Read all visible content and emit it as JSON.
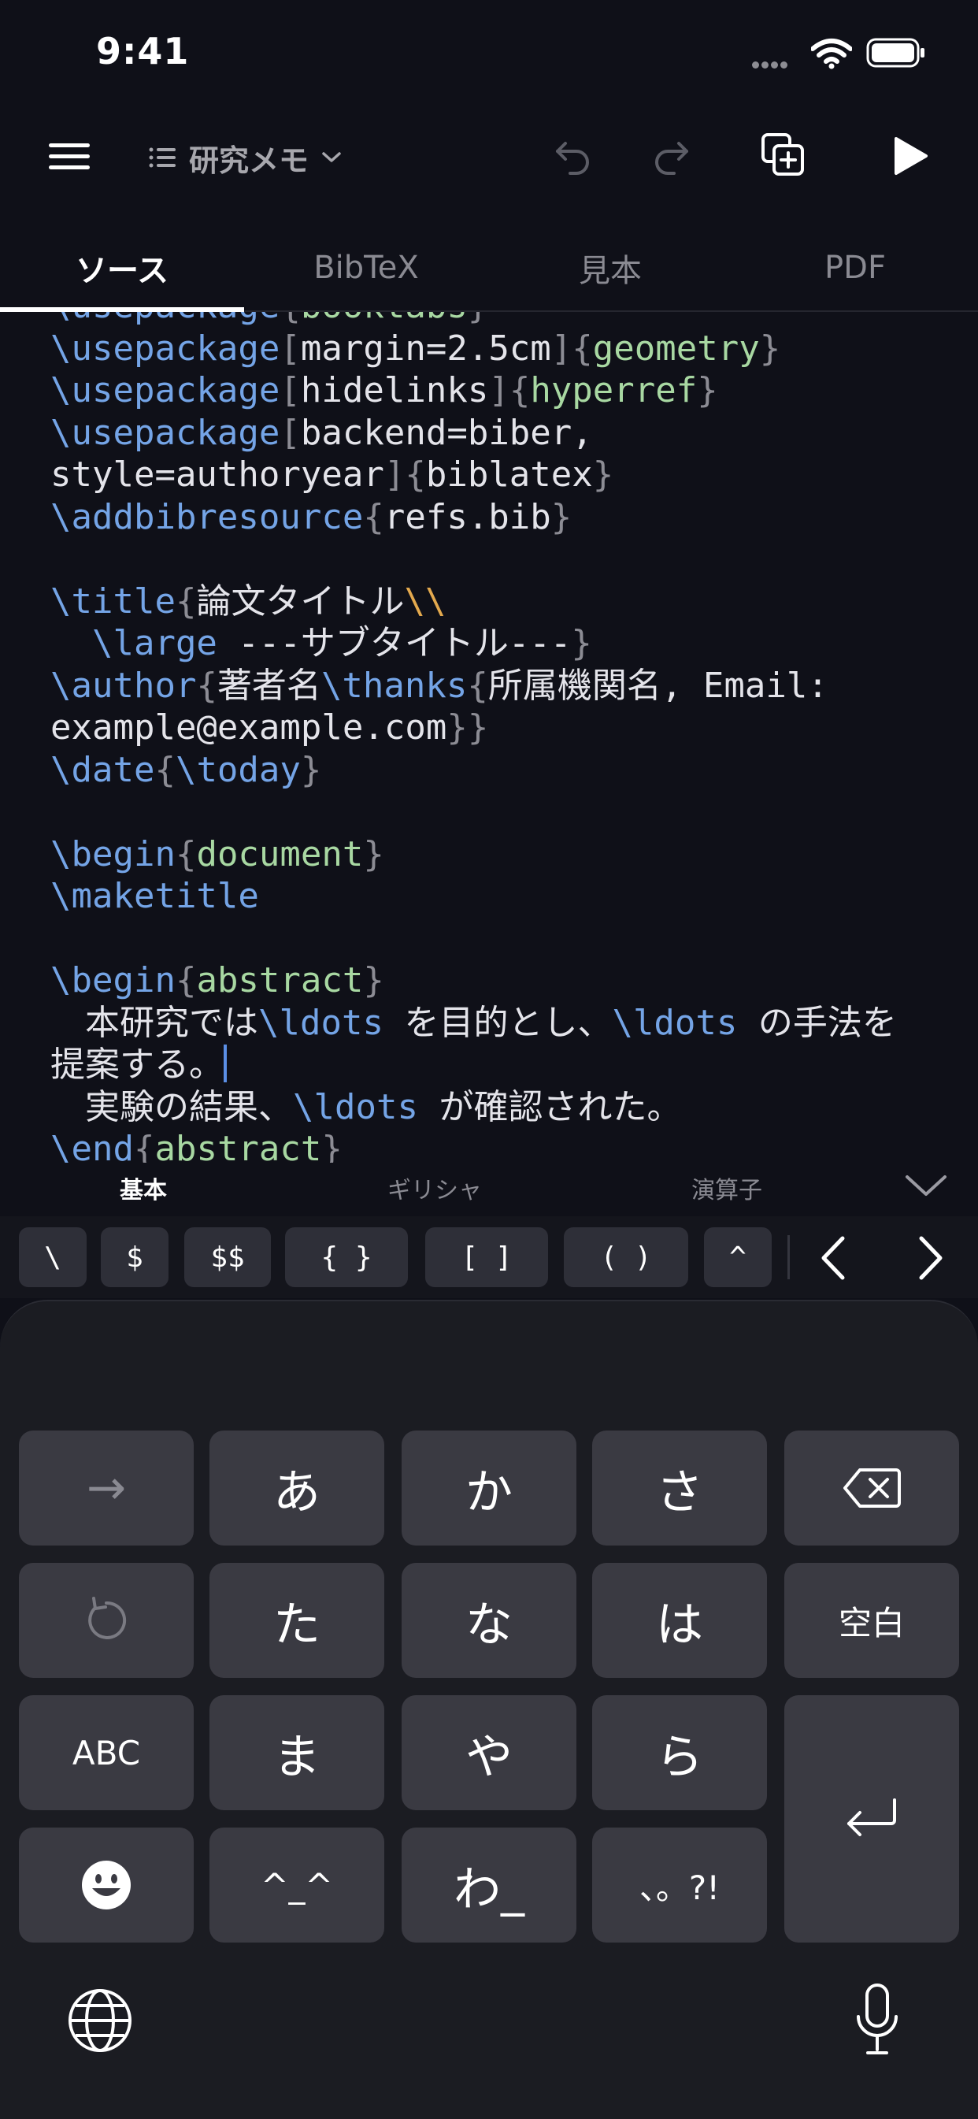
{
  "status": {
    "time": "9:41"
  },
  "toolbar": {
    "document_title": "研究メモ"
  },
  "tabs": [
    {
      "label": "ソース",
      "active": true
    },
    {
      "label": "BibTeX",
      "active": false
    },
    {
      "label": "見本",
      "active": false
    },
    {
      "label": "PDF",
      "active": false
    }
  ],
  "editor": {
    "lines": [
      "\\usepackage{booktabs}",
      "\\usepackage[margin=2.5cm]{geometry}",
      "\\usepackage[hidelinks]{hyperref}",
      "\\usepackage[backend=biber,",
      "style=authoryear]{biblatex}",
      "\\addbibresource{refs.bib}",
      "",
      "\\title{論文タイトル\\\\",
      "  \\large ---サブタイトル---}",
      "\\author{著者名\\thanks{所属機関名, Email:",
      "example@example.com}}",
      "\\date{\\today}",
      "",
      "\\begin{document}",
      "\\maketitle",
      "",
      "\\begin{abstract}",
      "　本研究では\\ldots を目的とし、\\ldots の手法を",
      "提案する。",
      "　実験の結果、\\ldots が確認された。",
      "\\end{abstract}"
    ]
  },
  "snippets": {
    "categories": [
      {
        "label": "基本",
        "active": true
      },
      {
        "label": "ギリシャ",
        "active": false
      },
      {
        "label": "演算子",
        "active": false
      }
    ],
    "keys": [
      "\\",
      "$",
      "$$",
      "{ }",
      "[ ]",
      "( )",
      "^"
    ]
  },
  "keyboard": {
    "rows": [
      [
        "→",
        "あ",
        "か",
        "さ",
        "⌫"
      ],
      [
        "↺",
        "た",
        "な",
        "は",
        "空白"
      ],
      [
        "ABC",
        "ま",
        "や",
        "ら",
        "↵"
      ],
      [
        "☻",
        "^_^",
        "わ_",
        "、。?!"
      ]
    ]
  },
  "colors": {
    "background": "#0f1018",
    "command": "#74a4e6",
    "environment": "#a8d8a2",
    "brace": "#8c8c94",
    "escaped": "#e3a94e",
    "caret": "#5b8fe6",
    "key": "#3a3a42"
  },
  "icons": [
    "wifi-icon",
    "battery-icon",
    "menu-icon",
    "list-icon",
    "chevron-down-icon",
    "undo-icon",
    "redo-icon",
    "duplicate-icon",
    "play-icon",
    "chevron-left-icon",
    "chevron-right-icon",
    "globe-icon",
    "mic-icon"
  ]
}
